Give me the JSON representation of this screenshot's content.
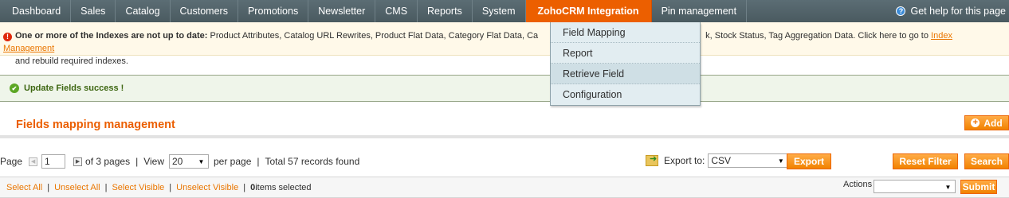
{
  "nav": {
    "items": [
      {
        "label": "Dashboard"
      },
      {
        "label": "Sales"
      },
      {
        "label": "Catalog"
      },
      {
        "label": "Customers"
      },
      {
        "label": "Promotions"
      },
      {
        "label": "Newsletter"
      },
      {
        "label": "CMS"
      },
      {
        "label": "Reports"
      },
      {
        "label": "System"
      },
      {
        "label": "ZohoCRM Integration"
      },
      {
        "label": "Pin management"
      }
    ],
    "active_item": "ZohoCRM Integration",
    "help": "Get help for this page"
  },
  "dropdown": {
    "items": [
      {
        "label": "Field Mapping"
      },
      {
        "label": "Report"
      },
      {
        "label": "Retrieve Field"
      },
      {
        "label": "Configuration"
      }
    ],
    "hovered_item": "Retrieve Field"
  },
  "notice": {
    "bold": "One or more of the Indexes are not up to date:",
    "text_a": " Product Attributes, Catalog URL Rewrites, Product Flat Data, Category Flat Data, Ca",
    "text_b": "k, Stock Status, Tag Aggregation Data. Click here to go to ",
    "link": "Index Management",
    "line2": "and rebuild required indexes."
  },
  "success": {
    "text": "Update Fields success !"
  },
  "page": {
    "title": "Fields mapping management",
    "add_label": "Add"
  },
  "pager": {
    "page_label": "Page",
    "page_value": "1",
    "of_pages": "of 3 pages",
    "view_label": "View",
    "view_value": "20",
    "per_page": "per page",
    "total": "Total 57 records found"
  },
  "export": {
    "label": "Export to:",
    "format": "CSV",
    "button": "Export"
  },
  "filter": {
    "reset": "Reset Filter",
    "search": "Search"
  },
  "massaction": {
    "select_all": "Select All",
    "unselect_all": "Unselect All",
    "select_visible": "Select Visible",
    "unselect_visible": "Unselect Visible",
    "count": "0",
    "count_suffix": " items selected",
    "actions_label": "Actions",
    "submit": "Submit"
  },
  "colors": {
    "accent": "#eb5e00",
    "nav_bg": "#4f5f66",
    "notice_bg": "#fff9e9",
    "success_bg": "#eff5ea",
    "menu_bg": "#e2edf1"
  }
}
